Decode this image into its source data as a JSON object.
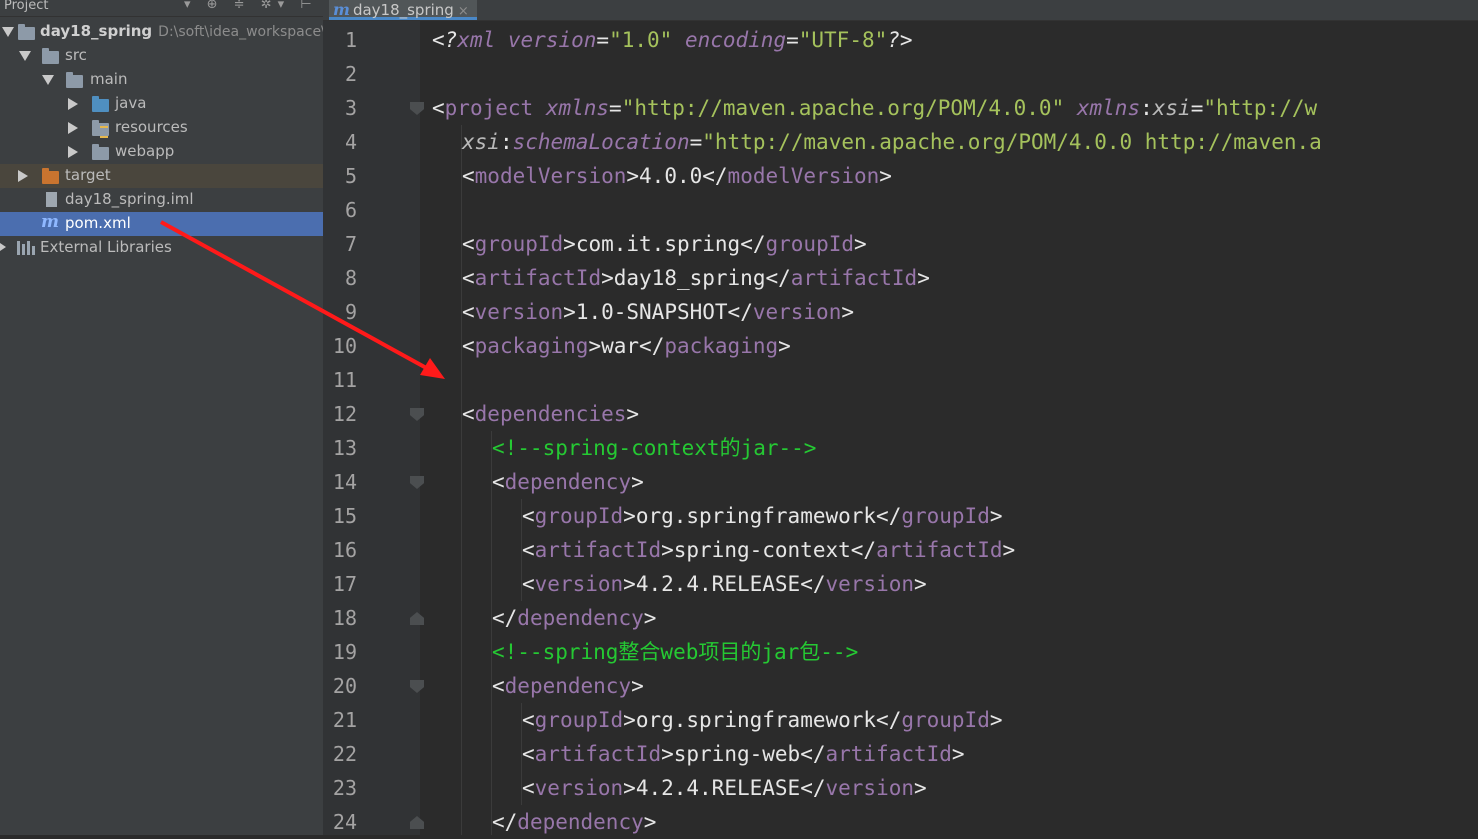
{
  "project_panel": {
    "title": "Project",
    "tools": "▾ ⊕ ≑ ✲▾ ⊢",
    "tree": [
      {
        "label": "day18_spring",
        "path": "D:\\soft\\idea_workspace\\"
      },
      {
        "label": "src"
      },
      {
        "label": "main"
      },
      {
        "label": "java"
      },
      {
        "label": "resources"
      },
      {
        "label": "webapp"
      },
      {
        "label": "target"
      },
      {
        "label": "day18_spring.iml"
      },
      {
        "label": "pom.xml"
      },
      {
        "label": "External Libraries"
      }
    ]
  },
  "editor": {
    "tab_label": "day18_spring",
    "tab_close": "×",
    "line_numbers": [
      "1",
      "2",
      "3",
      "4",
      "5",
      "6",
      "7",
      "8",
      "9",
      "10",
      "11",
      "12",
      "13",
      "14",
      "15",
      "16",
      "17",
      "18",
      "19",
      "20",
      "21",
      "22",
      "23",
      "24"
    ],
    "code": {
      "l1_decl": "<?",
      "l1_xml": "xml",
      "l1_ver_attr": "version",
      "l1_eq1": "=",
      "l1_ver_val": "\"1.0\"",
      "l1_enc_attr": "encoding",
      "l1_eq2": "=",
      "l1_enc_val": "\"UTF-8\"",
      "l1_end": "?>",
      "l3_open": "<",
      "l3_tag": "project",
      "l3_attr1": "xmlns",
      "l3_eq1": "=",
      "l3_val1": "\"http://maven.apache.org/POM/4.0.0\"",
      "l3_attr2_ns": "xmlns",
      "l3_colon": ":",
      "l3_attr2": "xsi",
      "l3_eq2": "=",
      "l3_val2": "\"http://w",
      "l4_ns": "xsi",
      "l4_colon": ":",
      "l4_attr": "schemaLocation",
      "l4_eq": "=",
      "l4_val": "\"http://maven.apache.org/POM/4.0.0 http://maven.a",
      "modelVersion": "modelVersion",
      "modelVersion_val": "4.0.0",
      "groupId": "groupId",
      "groupId_val": "com.it.spring",
      "artifactId": "artifactId",
      "artifactId_val": "day18_spring",
      "version": "version",
      "version_val": "1.0-SNAPSHOT",
      "packaging": "packaging",
      "packaging_val": "war",
      "dependencies": "dependencies",
      "comment1": "<!--spring-context的jar-->",
      "dependency": "dependency",
      "dep1_group": "org.springframework",
      "dep1_artifact": "spring-context",
      "dep1_version": "4.2.4.RELEASE",
      "comment2": "<!--spring整合web项目的jar包-->",
      "dep2_group": "org.springframework",
      "dep2_artifact": "spring-web",
      "dep2_version": "4.2.4.RELEASE"
    }
  },
  "colors": {
    "arrow": "#ff1a1a",
    "selection": "#4b6eaf",
    "comment": "#25c933",
    "tag": "#9876aa",
    "attr_value": "#a5c25c"
  }
}
